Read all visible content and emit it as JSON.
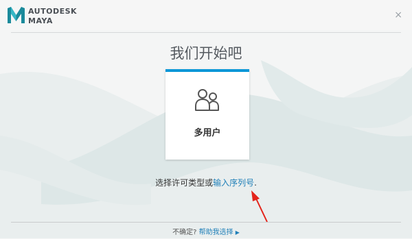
{
  "header": {
    "brand_line1": "AUTODESK",
    "brand_line2": "MAYA",
    "close_symbol": "×"
  },
  "main": {
    "title": "我们开始吧",
    "card": {
      "label": "多用户",
      "icon": "multi-user-icon"
    },
    "license_text": "选择许可类型或",
    "serial_link": "输入序列号",
    "period": "."
  },
  "footer": {
    "unsure_text": "不确定?",
    "help_link": "帮助我选择",
    "help_arrow": "▶"
  },
  "colors": {
    "accent": "#0696d7",
    "link": "#1f7fb8",
    "annotation_arrow": "#e3241b"
  }
}
